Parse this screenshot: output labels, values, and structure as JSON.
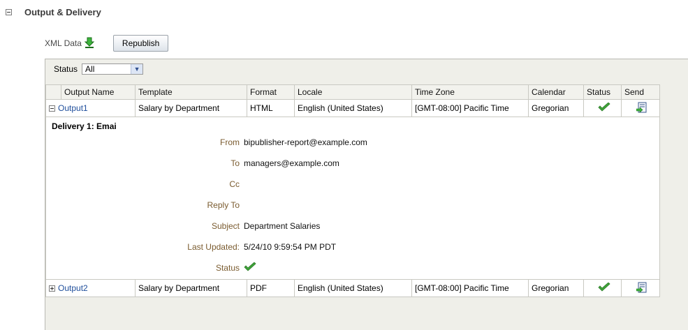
{
  "section": {
    "title": "Output & Delivery"
  },
  "toolbar": {
    "xml_data_label": "XML Data",
    "xml_icon": "download-arrow-icon",
    "republish_label": "Republish"
  },
  "filter": {
    "label": "Status",
    "value": "All"
  },
  "table": {
    "headers": [
      "Output Name",
      "Template",
      "Format",
      "Locale",
      "Time Zone",
      "Calendar",
      "Status",
      "Send"
    ],
    "rows": [
      {
        "name": "Output1",
        "template": "Salary by Department",
        "format": "HTML",
        "locale": "English (United States)",
        "timezone": "[GMT-08:00] Pacific Time",
        "calendar": "Gregorian",
        "status_icon": "check-icon",
        "send_icon": "send-document-icon",
        "expanded": true
      },
      {
        "name": "Output2",
        "template": "Salary by Department",
        "format": "PDF",
        "locale": "English (United States)",
        "timezone": "[GMT-08:00] Pacific Time",
        "calendar": "Gregorian",
        "status_icon": "check-icon",
        "send_icon": "send-document-icon",
        "expanded": false
      }
    ]
  },
  "delivery": {
    "title": "Delivery 1: Emai",
    "fields": {
      "from_label": "From",
      "from_value": "bipublisher-report@example.com",
      "to_label": "To",
      "to_value": "managers@example.com",
      "cc_label": "Cc",
      "cc_value": "",
      "reply_to_label": "Reply To",
      "reply_to_value": "",
      "subject_label": "Subject",
      "subject_value": "Department Salaries",
      "last_updated_label": "Last Updated:",
      "last_updated_value": "5/24/10 9:59:54 PM PDT",
      "status_label": "Status",
      "status_icon": "check-icon"
    }
  },
  "colors": {
    "link": "#1f4e9b",
    "label": "#7a5b2f",
    "check": "#3fa33a",
    "panel_bg": "#efefe9"
  }
}
